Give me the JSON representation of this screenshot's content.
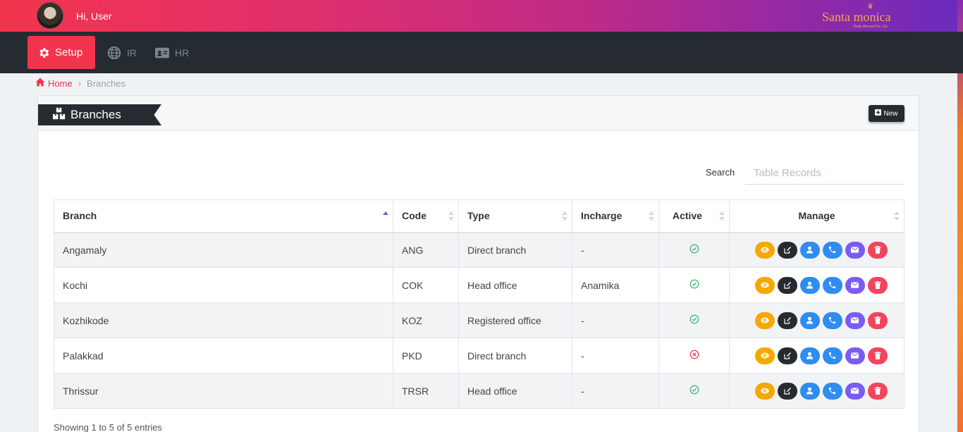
{
  "header": {
    "greeting": "Hi, User",
    "logo_text": "Santa monica",
    "logo_subtext": "Study Abroad Pvt. Ltd."
  },
  "nav": [
    {
      "label": "Setup",
      "icon": "gear-icon",
      "active": true
    },
    {
      "label": "IR",
      "icon": "globe-icon",
      "active": false
    },
    {
      "label": "HR",
      "icon": "id-card-icon",
      "active": false
    }
  ],
  "breadcrumb": {
    "home": "Home",
    "current": "Branches"
  },
  "page": {
    "title": "Branches",
    "new_label": "New"
  },
  "search": {
    "label": "Search",
    "placeholder": "Table Records"
  },
  "table": {
    "columns": [
      "Branch",
      "Code",
      "Type",
      "Incharge",
      "Active",
      "Manage"
    ],
    "rows": [
      {
        "branch": "Angamaly",
        "code": "ANG",
        "type": "Direct branch",
        "incharge": "-",
        "active": true
      },
      {
        "branch": "Kochi",
        "code": "COK",
        "type": "Head office",
        "incharge": "Anamika",
        "active": true
      },
      {
        "branch": "Kozhikode",
        "code": "KOZ",
        "type": "Registered office",
        "incharge": "-",
        "active": true
      },
      {
        "branch": "Palakkad",
        "code": "PKD",
        "type": "Direct branch",
        "incharge": "-",
        "active": false
      },
      {
        "branch": "Thrissur",
        "code": "TRSR",
        "type": "Head office",
        "incharge": "-",
        "active": true
      }
    ]
  },
  "footer": {
    "info": "Showing 1 to 5 of 5 entries"
  },
  "colors": {
    "accent": "#f3344d",
    "dark": "#262b31",
    "active_check": "#3cb371",
    "inactive": "#f3344d"
  }
}
